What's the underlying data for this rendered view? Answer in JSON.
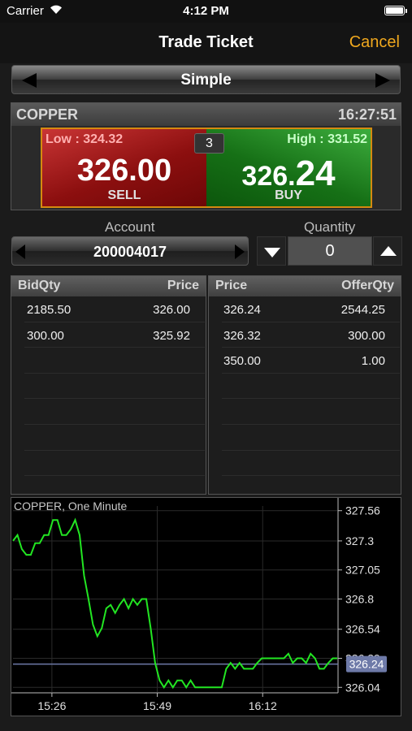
{
  "status_bar": {
    "carrier": "Carrier",
    "time": "4:12 PM"
  },
  "nav": {
    "title": "Trade Ticket",
    "cancel_label": "Cancel"
  },
  "mode": {
    "label": "Simple"
  },
  "quote": {
    "symbol": "COPPER",
    "time": "16:27:51",
    "low_text": "Low : 324.32",
    "high_text": "High : 331.52",
    "spread": "3",
    "sell": {
      "price_main": "326.",
      "price_pips": "00",
      "label": "SELL"
    },
    "buy": {
      "price_main": "326.",
      "price_pips": "24",
      "label": "BUY"
    }
  },
  "account": {
    "label": "Account",
    "value": "200004017"
  },
  "quantity": {
    "label": "Quantity",
    "value": "0"
  },
  "bid_book": {
    "headers": [
      "BidQty",
      "Price"
    ],
    "rows": [
      {
        "qty": "2185.50",
        "price": "326.00"
      },
      {
        "qty": "300.00",
        "price": "325.92"
      },
      {
        "qty": "",
        "price": ""
      },
      {
        "qty": "",
        "price": ""
      },
      {
        "qty": "",
        "price": ""
      },
      {
        "qty": "",
        "price": ""
      },
      {
        "qty": "",
        "price": ""
      }
    ]
  },
  "offer_book": {
    "headers": [
      "Price",
      "OfferQty"
    ],
    "rows": [
      {
        "price": "326.24",
        "qty": "2544.25"
      },
      {
        "price": "326.32",
        "qty": "300.00"
      },
      {
        "price": "350.00",
        "qty": "1.00"
      },
      {
        "price": "",
        "qty": ""
      },
      {
        "price": "",
        "qty": ""
      },
      {
        "price": "",
        "qty": ""
      },
      {
        "price": "",
        "qty": ""
      }
    ]
  },
  "chart_data": {
    "type": "line",
    "title": "COPPER, One Minute",
    "y_ticks": [
      "327.56",
      "327.3",
      "327.05",
      "326.8",
      "326.54",
      "326.29",
      "326.04"
    ],
    "x_ticks": [
      "15:26",
      "15:49",
      "16:12"
    ],
    "ylim": [
      326.0,
      327.6
    ],
    "current_price": 326.24,
    "current_price_label": "326.24",
    "line_color": "#22e622",
    "series": [
      {
        "values": [
          327.3,
          327.35,
          327.23,
          327.18,
          327.18,
          327.28,
          327.28,
          327.35,
          327.35,
          327.48,
          327.48,
          327.35,
          327.35,
          327.4,
          327.48,
          327.35,
          327.0,
          326.8,
          326.58,
          326.48,
          326.55,
          326.72,
          326.75,
          326.68,
          326.75,
          326.8,
          326.72,
          326.8,
          326.75,
          326.8,
          326.8,
          326.55,
          326.25,
          326.1,
          326.04,
          326.1,
          326.04,
          326.1,
          326.1,
          326.04,
          326.1,
          326.04,
          326.04,
          326.04,
          326.04,
          326.04,
          326.04,
          326.04,
          326.2,
          326.25,
          326.2,
          326.25,
          326.2,
          326.2,
          326.2,
          326.25,
          326.29,
          326.29,
          326.29,
          326.29,
          326.29,
          326.29,
          326.33,
          326.25,
          326.29,
          326.29,
          326.25,
          326.33,
          326.29,
          326.2,
          326.2,
          326.25,
          326.29,
          326.29
        ]
      }
    ]
  }
}
